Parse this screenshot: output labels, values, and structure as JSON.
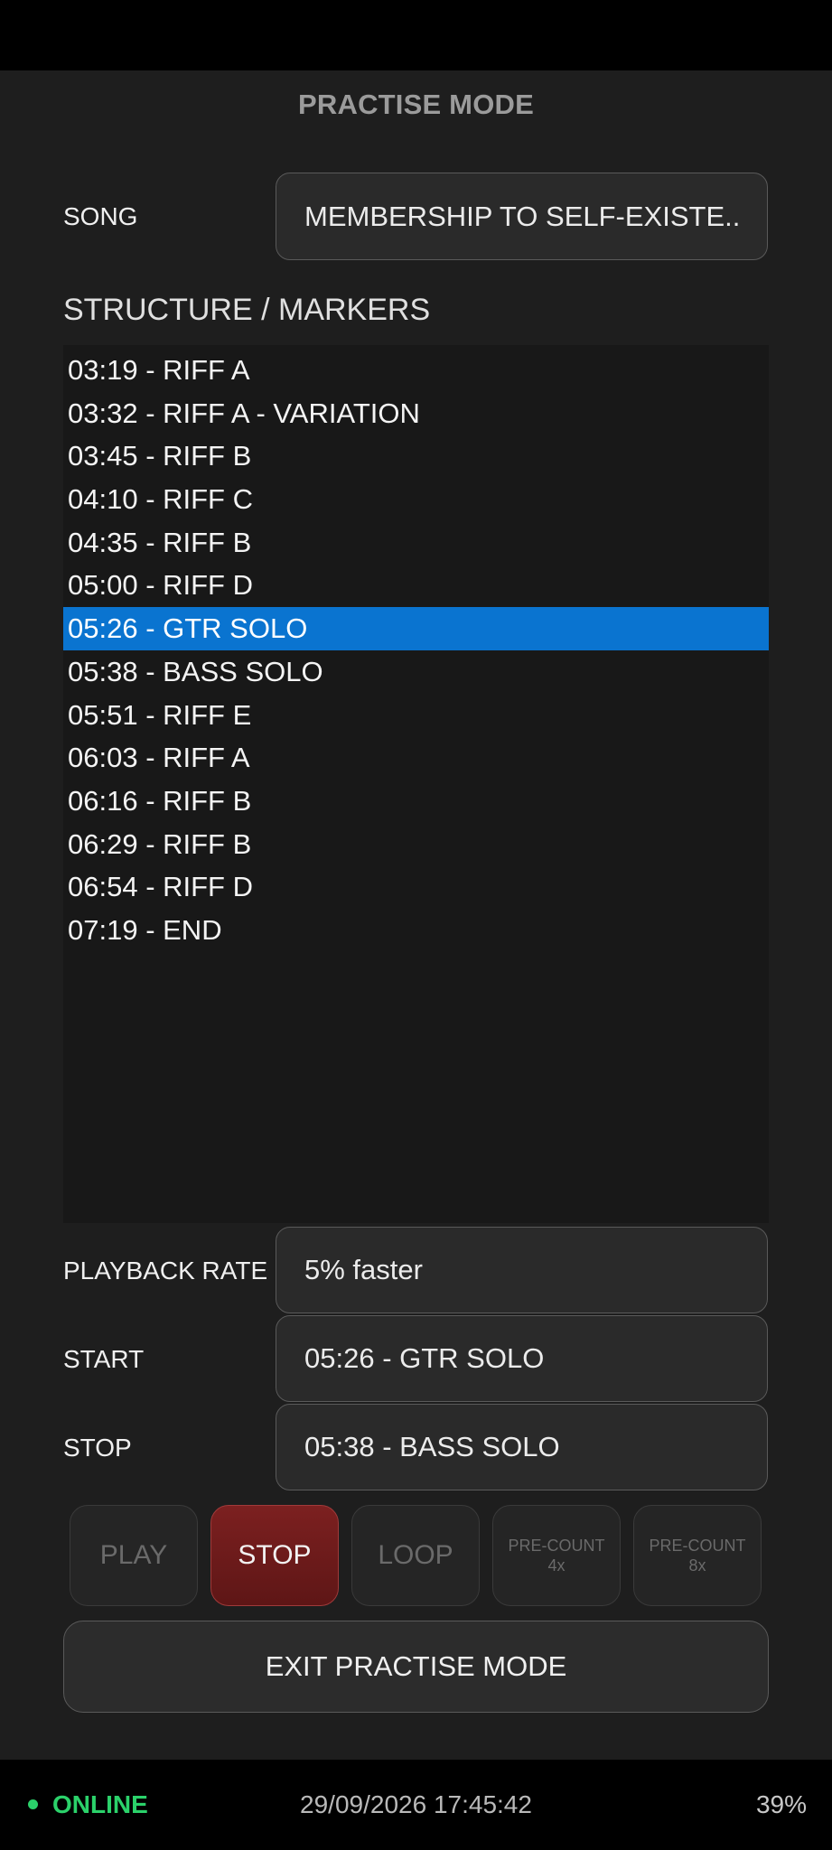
{
  "header": {
    "title": "PRACTISE MODE"
  },
  "song": {
    "label": "SONG",
    "value": "MEMBERSHIP TO SELF-EXISTE.."
  },
  "structure": {
    "title": "STRUCTURE / MARKERS",
    "markers": [
      "03:19 - RIFF A",
      "03:32 - RIFF A - VARIATION",
      "03:45 - RIFF B",
      "04:10 - RIFF C",
      "04:35 - RIFF B",
      "05:00 - RIFF D",
      "05:26 - GTR SOLO",
      "05:38 - BASS SOLO",
      "05:51 - RIFF E",
      "06:03 - RIFF A",
      "06:16 - RIFF B",
      "06:29 - RIFF B",
      "06:54 - RIFF D",
      "07:19 - END"
    ],
    "selected_index": 6
  },
  "playback_rate": {
    "label": "PLAYBACK RATE",
    "value": "5% faster"
  },
  "start": {
    "label": "START",
    "value": "05:26 - GTR SOLO"
  },
  "stop": {
    "label": "STOP",
    "value": "05:38 - BASS SOLO"
  },
  "transport": {
    "play": "PLAY",
    "stop": "STOP",
    "loop": "LOOP",
    "precount4_line1": "PRE-COUNT",
    "precount4_line2": "4x",
    "precount8_line1": "PRE-COUNT",
    "precount8_line2": "8x"
  },
  "exit_button": "EXIT PRACTISE MODE",
  "status": {
    "connection": "ONLINE",
    "datetime": "29/09/2026 17:45:42",
    "battery": "39%"
  },
  "colors": {
    "selection": "#0a74d0",
    "online": "#2bd16a",
    "stop_active": "#7c2020"
  }
}
